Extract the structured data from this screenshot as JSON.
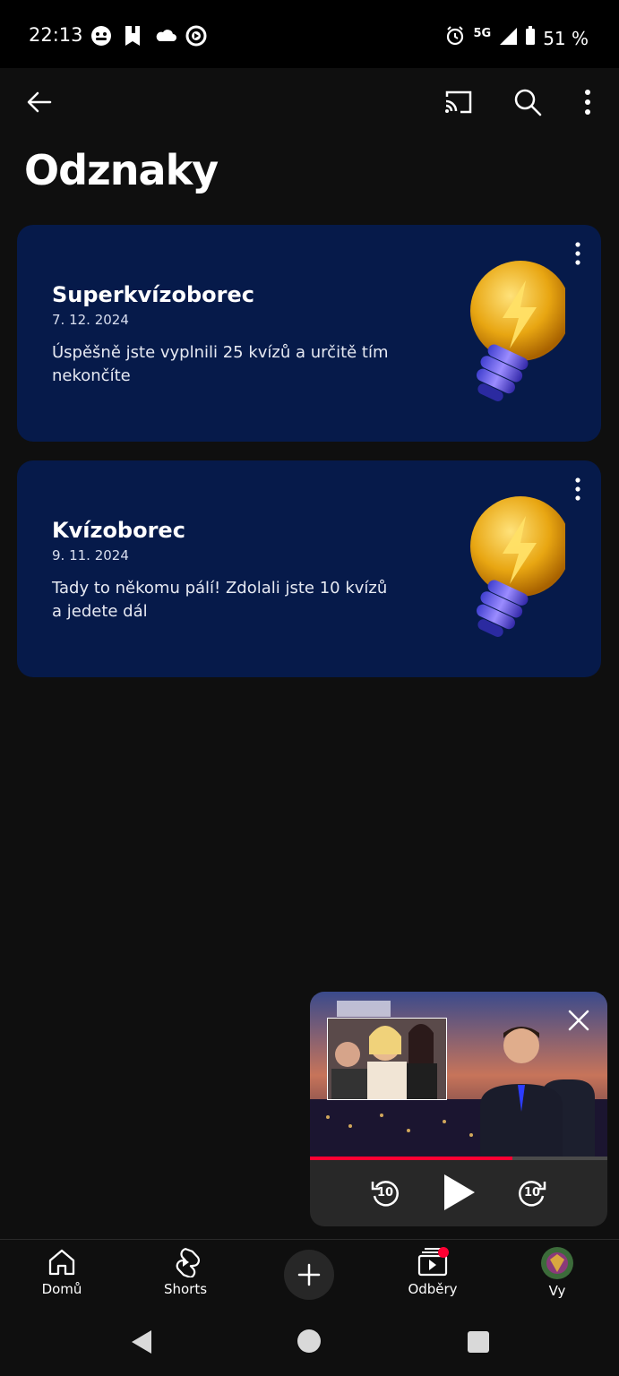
{
  "status": {
    "time": "22:13",
    "network": "5G",
    "battery": "51 %"
  },
  "page": {
    "title": "Odznaky"
  },
  "badges": [
    {
      "title": "Superkvízoborec",
      "date": "7. 12. 2024",
      "description": "Úspěšně jste vyplnili 25 kvízů a určitě tím nekončíte"
    },
    {
      "title": "Kvízoborec",
      "date": "9. 11. 2024",
      "description": "Tady to někomu pálí! Zdolali jste 10 kvízů a jedete dál"
    }
  ],
  "mini_player": {
    "progress": 0.68,
    "rewind_label": "10",
    "forward_label": "10"
  },
  "nav": {
    "home": "Domů",
    "shorts": "Shorts",
    "subscriptions": "Odběry",
    "you": "Vy"
  },
  "colors": {
    "background": "#0f0f0f",
    "card": "#061a4a",
    "accent": "#ff0033"
  }
}
